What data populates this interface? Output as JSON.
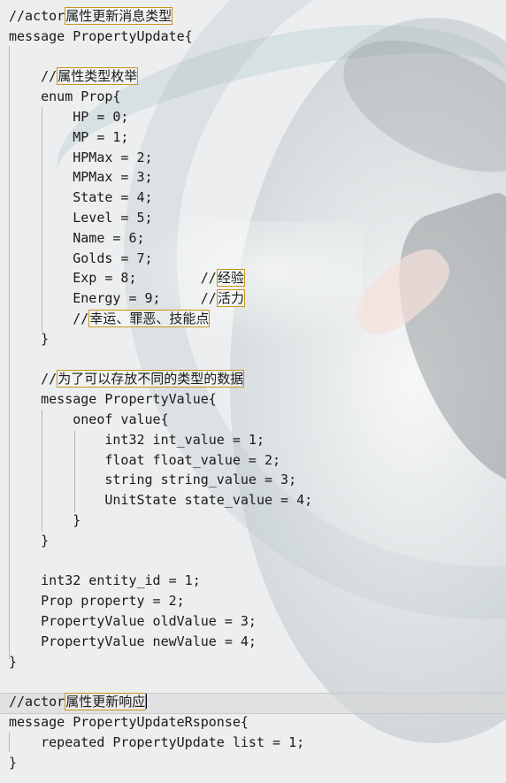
{
  "editor": {
    "lines": [
      {
        "indent": "",
        "code": "//actor",
        "hl": "属性更新消息类型"
      },
      {
        "indent": "",
        "code": "message PropertyUpdate{"
      },
      {
        "indent": "",
        "code": ""
      },
      {
        "indent": "    ",
        "code": "//",
        "hl": "属性类型枚举"
      },
      {
        "indent": "    ",
        "code": "enum Prop{"
      },
      {
        "indent": "        ",
        "code": "HP = 0;"
      },
      {
        "indent": "        ",
        "code": "MP = 1;"
      },
      {
        "indent": "        ",
        "code": "HPMax = 2;"
      },
      {
        "indent": "        ",
        "code": "MPMax = 3;"
      },
      {
        "indent": "        ",
        "code": "State = 4;"
      },
      {
        "indent": "        ",
        "code": "Level = 5;"
      },
      {
        "indent": "        ",
        "code": "Name = 6;"
      },
      {
        "indent": "        ",
        "code": "Golds = 7;"
      },
      {
        "indent": "        ",
        "code": "Exp = 8;        //",
        "hl": "经验"
      },
      {
        "indent": "        ",
        "code": "Energy = 9;     //",
        "hl": "活力"
      },
      {
        "indent": "        ",
        "code": "//",
        "hl": "幸运、罪恶、技能点"
      },
      {
        "indent": "    ",
        "code": "}"
      },
      {
        "indent": "",
        "code": ""
      },
      {
        "indent": "    ",
        "code": "//",
        "hl": "为了可以存放不同的类型的数据"
      },
      {
        "indent": "    ",
        "code": "message PropertyValue{"
      },
      {
        "indent": "        ",
        "code": "oneof value{"
      },
      {
        "indent": "            ",
        "code": "int32 int_value = 1;"
      },
      {
        "indent": "            ",
        "code": "float float_value = 2;"
      },
      {
        "indent": "            ",
        "code": "string string_value = 3;"
      },
      {
        "indent": "            ",
        "code": "UnitState state_value = 4;"
      },
      {
        "indent": "        ",
        "code": "}"
      },
      {
        "indent": "    ",
        "code": "}"
      },
      {
        "indent": "",
        "code": ""
      },
      {
        "indent": "    ",
        "code": "int32 entity_id = 1;"
      },
      {
        "indent": "    ",
        "code": "Prop property = 2;"
      },
      {
        "indent": "    ",
        "code": "PropertyValue oldValue = 3;"
      },
      {
        "indent": "    ",
        "code": "PropertyValue newValue = 4;"
      },
      {
        "indent": "",
        "code": "}"
      },
      {
        "indent": "",
        "code": ""
      },
      {
        "indent": "",
        "code": "//actor",
        "hl": "属性更新响应",
        "cursor": true
      },
      {
        "indent": "",
        "code": "message PropertyUpdateRsponse{"
      },
      {
        "indent": "    ",
        "code": "repeated PropertyUpdate list = 1;"
      },
      {
        "indent": "",
        "code": "}"
      }
    ]
  },
  "colors": {
    "highlight_border": "#c8951c",
    "current_line": "#d7d7d7",
    "indent_guide": "#b4b8ba"
  }
}
